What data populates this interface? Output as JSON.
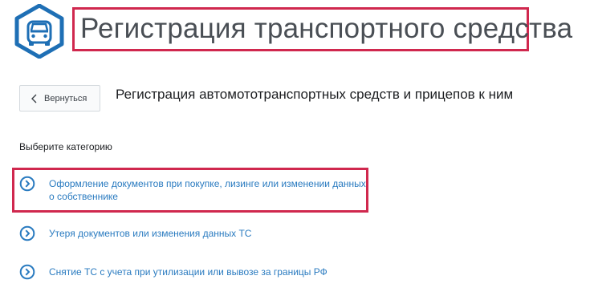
{
  "colors": {
    "accent_blue": "#2a7bc0",
    "highlight_red": "#d0284e",
    "icon_blue": "#1e6fb5"
  },
  "header": {
    "icon": "car-icon",
    "title": "Регистрация транспортного средства"
  },
  "toolbar": {
    "back_label": "Вернуться",
    "back_icon": "chevron-left-icon"
  },
  "subtitle": "Регистрация автомототранспортных средств и прицепов к ним",
  "categories": {
    "label": "Выберите категорию",
    "items": [
      {
        "text": "Оформление документов при покупке, лизинге или изменении данных о собственнике",
        "icon": "arrow-right-circle-icon"
      },
      {
        "text": "Утеря документов или изменения данных ТС",
        "icon": "arrow-right-circle-icon"
      },
      {
        "text": "Снятие ТС с учета при утилизации или вывозе за границы РФ",
        "icon": "arrow-right-circle-icon"
      }
    ]
  }
}
